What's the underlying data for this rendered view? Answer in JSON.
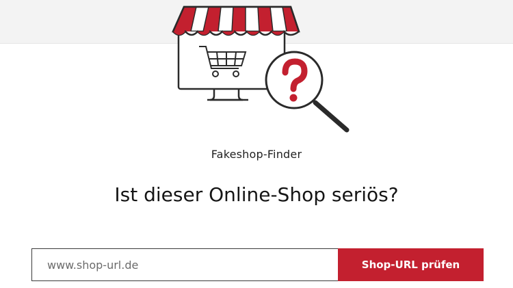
{
  "finder": {
    "label": "Fakeshop-Finder",
    "headline": "Ist dieser Online-Shop seriös?"
  },
  "search": {
    "placeholder": "www.shop-url.de",
    "value": "",
    "button_label": "Shop-URL prüfen"
  },
  "illustration": {
    "icons": [
      "shop-awning-icon",
      "monitor-icon",
      "shopping-cart-icon",
      "magnifier-question-icon"
    ]
  },
  "colors": {
    "accent": "#c3202f",
    "band": "#f3f3f3",
    "text": "#1a1a1a"
  }
}
